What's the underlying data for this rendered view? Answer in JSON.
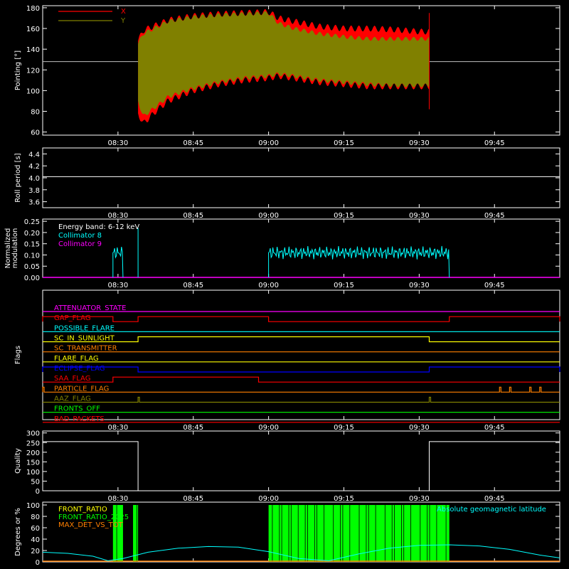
{
  "chart_data": [
    {
      "type": "area",
      "ylabel": "Pointing [°]",
      "ylim": [
        57,
        182
      ],
      "yticks": [
        "60",
        "80",
        "100",
        "120",
        "140",
        "160",
        "180"
      ],
      "xticks": [
        "08:30",
        "08:45",
        "09:00",
        "09:15",
        "09:30",
        "09:45"
      ],
      "xrange": [
        "08:15",
        "09:58"
      ],
      "legend": [
        "X",
        "Y"
      ],
      "colors": {
        "X": "#ff0000",
        "Y": "#808000",
        "line": "#c0c0c0"
      },
      "reference_line": 128,
      "series": [
        {
          "name": "X",
          "x": [
            "08:34",
            "08:35",
            "08:38",
            "08:40",
            "08:45",
            "08:50",
            "08:55",
            "09:00",
            "09:02",
            "09:05",
            "09:10",
            "09:15",
            "09:20",
            "09:25",
            "09:30",
            "09:32"
          ],
          "upper": [
            148,
            158,
            164,
            168,
            172,
            174,
            175,
            176,
            170,
            167,
            162,
            160,
            160,
            159,
            157,
            157
          ],
          "lower": [
            78,
            68,
            82,
            90,
            100,
            106,
            110,
            112,
            114,
            112,
            108,
            106,
            104,
            104,
            104,
            104
          ]
        },
        {
          "name": "Y",
          "x": [
            "08:34",
            "08:35",
            "08:38",
            "08:40",
            "08:45",
            "08:50",
            "08:55",
            "09:00",
            "09:02",
            "09:05",
            "09:10",
            "09:15",
            "09:20",
            "09:25",
            "09:30",
            "09:32"
          ],
          "upper": [
            145,
            155,
            162,
            167,
            171,
            173,
            174,
            175,
            165,
            160,
            155,
            152,
            150,
            150,
            150,
            150
          ],
          "lower": [
            90,
            75,
            86,
            94,
            102,
            108,
            112,
            114,
            116,
            114,
            110,
            108,
            106,
            105,
            105,
            105
          ]
        }
      ]
    },
    {
      "type": "line",
      "ylabel": "Roll period [s]",
      "ylim": [
        3.5,
        4.5
      ],
      "yticks": [
        "3.6",
        "3.8",
        "4.0",
        "4.2",
        "4.4"
      ],
      "xticks": [
        "08:30",
        "08:45",
        "09:00",
        "09:15",
        "09:30",
        "09:45"
      ],
      "series": [
        {
          "name": "",
          "x": [
            "08:15",
            "09:58"
          ],
          "values": [
            4.02,
            4.02
          ]
        }
      ]
    },
    {
      "type": "line",
      "ylabel": "Normalized modulation",
      "ylim": [
        0,
        0.26
      ],
      "yticks": [
        "0.00",
        "0.05",
        "0.10",
        "0.15",
        "0.20",
        "0.25"
      ],
      "xticks": [
        "08:30",
        "08:45",
        "09:00",
        "09:15",
        "09:30",
        "09:45"
      ],
      "annotation": "Energy band: 6-12 keV",
      "legend": [
        "Collimator 8",
        "Collimator 9"
      ],
      "colors": {
        "Collimator 8": "#00ffff",
        "Collimator 9": "#ff00ff"
      },
      "series": [
        {
          "name": "Collimator 8",
          "segments": [
            [
              "08:29",
              "08:31",
              0.08,
              0.14
            ],
            [
              "09:00",
              "09:36",
              0.08,
              0.14
            ]
          ],
          "spike": [
            "08:34",
            0.22
          ]
        },
        {
          "name": "Collimator 9",
          "values": [
            0,
            0
          ]
        }
      ]
    },
    {
      "type": "line",
      "ylabel": "Flags",
      "xticks": [
        "08:30",
        "08:45",
        "09:00",
        "09:15",
        "09:30",
        "09:45"
      ],
      "flags": [
        {
          "name": "ATTENUATOR_STATE",
          "color": "#ff00ff",
          "on": []
        },
        {
          "name": "GAP_FLAG",
          "color": "#ff0000",
          "on": [
            [
              "08:15",
              "08:29"
            ],
            [
              "08:34",
              "09:00"
            ],
            [
              "09:36",
              "09:58"
            ]
          ]
        },
        {
          "name": "POSSIBLE_FLARE",
          "color": "#00ffff",
          "on": []
        },
        {
          "name": "SC_IN_SUNLIGHT",
          "color": "#ffff00",
          "on": [
            [
              "08:34",
              "09:32"
            ]
          ]
        },
        {
          "name": "SC_TRANSMITTER",
          "color": "#ff7f00",
          "on": []
        },
        {
          "name": "FLARE_FLAG",
          "color": "#ffff00",
          "on": []
        },
        {
          "name": "ECLIPSE_FLAG",
          "color": "#0000ff",
          "on": [
            [
              "08:15",
              "08:34"
            ],
            [
              "09:32",
              "09:58"
            ]
          ]
        },
        {
          "name": "SAA_FLAG",
          "color": "#ff0000",
          "on": [
            [
              "08:29",
              "08:58"
            ]
          ]
        },
        {
          "name": "PARTICLE_FLAG",
          "color": "#ff7f00",
          "on": [
            [
              "08:15",
              "08:15"
            ],
            [
              "09:46",
              "09:46"
            ],
            [
              "09:48",
              "09:48"
            ],
            [
              "09:52",
              "09:52"
            ],
            [
              "09:54",
              "09:54"
            ]
          ]
        },
        {
          "name": "AAZ_FLAG",
          "color": "#808000",
          "on": [
            [
              "08:34",
              "08:34"
            ],
            [
              "09:32",
              "09:32"
            ]
          ]
        },
        {
          "name": "FRONTS_OFF",
          "color": "#00ff00",
          "on": []
        },
        {
          "name": "BAD_PACKETS",
          "color": "#ff0000",
          "on": []
        }
      ]
    },
    {
      "type": "line",
      "ylabel": "Quality",
      "ylim": [
        0,
        310
      ],
      "yticks": [
        "0",
        "50",
        "100",
        "150",
        "200",
        "250",
        "300"
      ],
      "xticks": [
        "08:30",
        "08:45",
        "09:00",
        "09:15",
        "09:30",
        "09:45"
      ],
      "series": [
        {
          "name": "",
          "x": [
            "08:15",
            "08:34",
            "08:34",
            "09:32",
            "09:32",
            "09:58"
          ],
          "values": [
            255,
            255,
            0,
            0,
            255,
            255
          ]
        }
      ]
    },
    {
      "type": "line",
      "ylabel": "Degrees or %",
      "ylim": [
        0,
        105
      ],
      "yticks": [
        "0",
        "20",
        "40",
        "60",
        "80",
        "100"
      ],
      "legend": [
        "FRONT_RATIO",
        "FRONT_RATIO_2025",
        "MAX_DET_VS_TOT"
      ],
      "colors": {
        "FRONT_RATIO": "#ffff00",
        "FRONT_RATIO_2025": "#00ff00",
        "MAX_DET_VS_TOT": "#ff7f00",
        "Absolute geomagnetic latitude": "#00ffff"
      },
      "annotation": "Absolute geomagnetic latitude",
      "front_ratio_bands": [
        [
          "08:29",
          "08:31"
        ],
        [
          "08:33",
          "08:34"
        ],
        [
          "09:00",
          "09:36"
        ]
      ],
      "series": [
        {
          "name": "Absolute geomagnetic latitude",
          "x": [
            "08:15",
            "08:20",
            "08:25",
            "08:28",
            "08:31",
            "08:36",
            "08:42",
            "08:48",
            "08:54",
            "09:00",
            "09:06",
            "09:12",
            "09:18",
            "09:24",
            "09:30",
            "09:36",
            "09:42",
            "09:48",
            "09:54",
            "09:58"
          ],
          "values": [
            17,
            15,
            10,
            2,
            6,
            17,
            24,
            27,
            26,
            18,
            6,
            2,
            14,
            24,
            29,
            30,
            28,
            22,
            12,
            7
          ]
        }
      ]
    }
  ]
}
